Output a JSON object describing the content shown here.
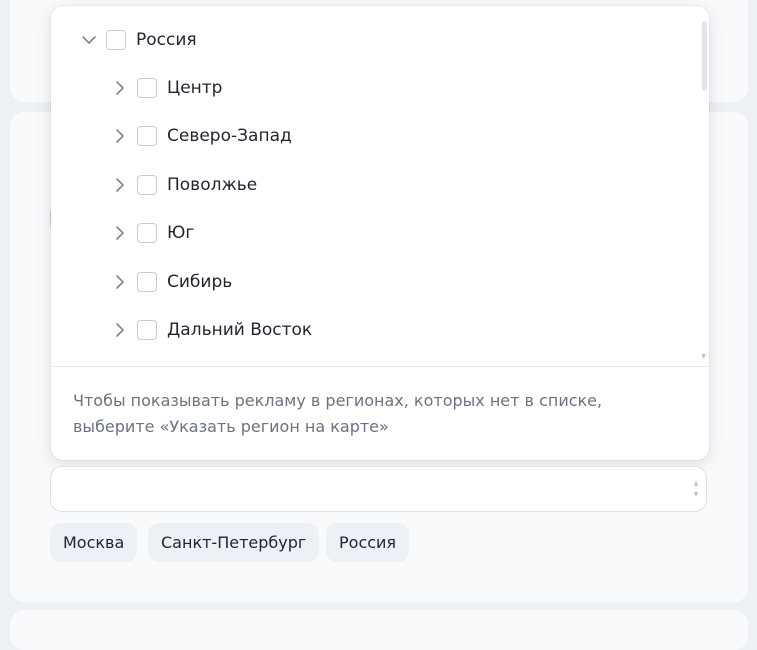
{
  "region_tree": {
    "root": {
      "label": "Россия",
      "expanded": true,
      "checked": false
    },
    "children": [
      {
        "label": "Центр",
        "checked": false
      },
      {
        "label": "Северо-Запад",
        "checked": false
      },
      {
        "label": "Поволжье",
        "checked": false
      },
      {
        "label": "Юг",
        "checked": false
      },
      {
        "label": "Сибирь",
        "checked": false
      },
      {
        "label": "Дальний Восток",
        "checked": false
      }
    ]
  },
  "hint_text": "Чтобы показывать рекламу в регионах, которых нет в списке, выберите «Указать регион на карте»",
  "search": {
    "value": "",
    "placeholder": ""
  },
  "chips": [
    "Москва",
    "Санкт-Петербург",
    "Россия"
  ],
  "icons": {
    "expand": "chevron-down-icon",
    "collapse": "chevron-right-icon"
  },
  "colors": {
    "page_background": "#edf0f5",
    "card": "#f9fafc",
    "text": "#1f2430",
    "muted_text": "#6b7281",
    "chip_background": "#edf0f5"
  }
}
